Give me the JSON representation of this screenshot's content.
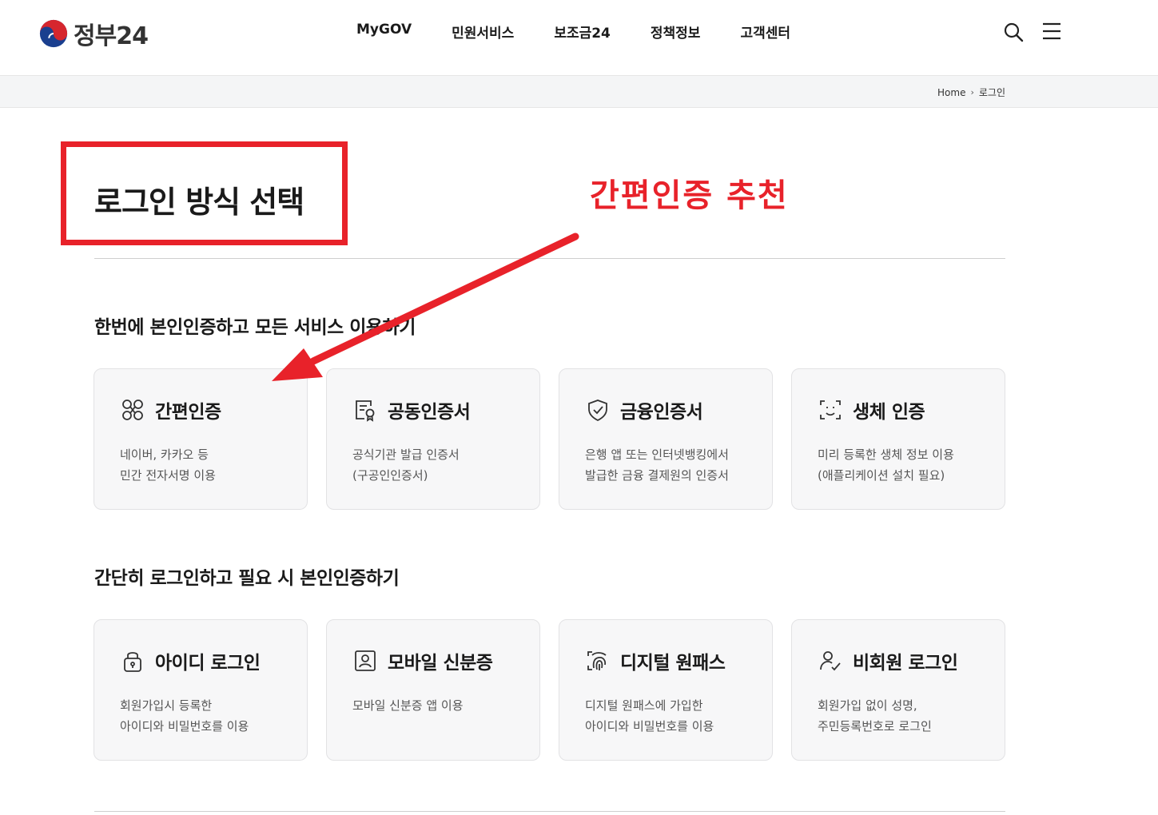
{
  "header": {
    "logo_text": "정부24",
    "nav": [
      "MyGOV",
      "민원서비스",
      "보조금24",
      "정책정보",
      "고객센터"
    ],
    "icons": {
      "search": "search-icon",
      "menu": "hamburger-menu-icon"
    }
  },
  "breadcrumb": {
    "home": "Home",
    "current": "로그인"
  },
  "page": {
    "title": "로그인 방식 선택",
    "annotation": "간편인증 추천"
  },
  "sections": [
    {
      "heading": "한번에 본인인증하고 모든 서비스 이용하기",
      "cards": [
        {
          "title": "간편인증",
          "icon": "simple-auth-icon",
          "desc": [
            "네이버, 카카오 등",
            "민간 전자서명 이용"
          ]
        },
        {
          "title": "공동인증서",
          "icon": "certificate-icon",
          "desc": [
            "공식기관 발급 인증서",
            "(구공인인증서)"
          ]
        },
        {
          "title": "금융인증서",
          "icon": "shield-check-icon",
          "desc": [
            "은행 앱 또는 인터넷뱅킹에서",
            "발급한 금융 결제원의 인증서"
          ]
        },
        {
          "title": "생체 인증",
          "icon": "face-scan-icon",
          "desc": [
            "미리 등록한 생체 정보 이용",
            "(애플리케이션 설치 필요)"
          ]
        }
      ]
    },
    {
      "heading": "간단히 로그인하고 필요 시 본인인증하기",
      "cards": [
        {
          "title": "아이디 로그인",
          "icon": "lock-icon",
          "desc": [
            "회원가입시 등록한",
            "아이디와 비밀번호를 이용"
          ]
        },
        {
          "title": "모바일 신분증",
          "icon": "id-card-icon",
          "desc": [
            "모바일 신분증 앱 이용"
          ]
        },
        {
          "title": "디지털 원패스",
          "icon": "fingerprint-icon",
          "desc": [
            "디지털 원패스에 가입한",
            "아이디와 비밀번호를 이용"
          ]
        },
        {
          "title": "비회원 로그인",
          "icon": "user-check-icon",
          "desc": [
            "회원가입 없이 성명,",
            "주민등록번호로 로그인"
          ]
        }
      ]
    }
  ],
  "colors": {
    "annotation_red": "#e8222a",
    "card_bg": "#f7f7f8",
    "crumb_bg": "#f4f5f6"
  }
}
